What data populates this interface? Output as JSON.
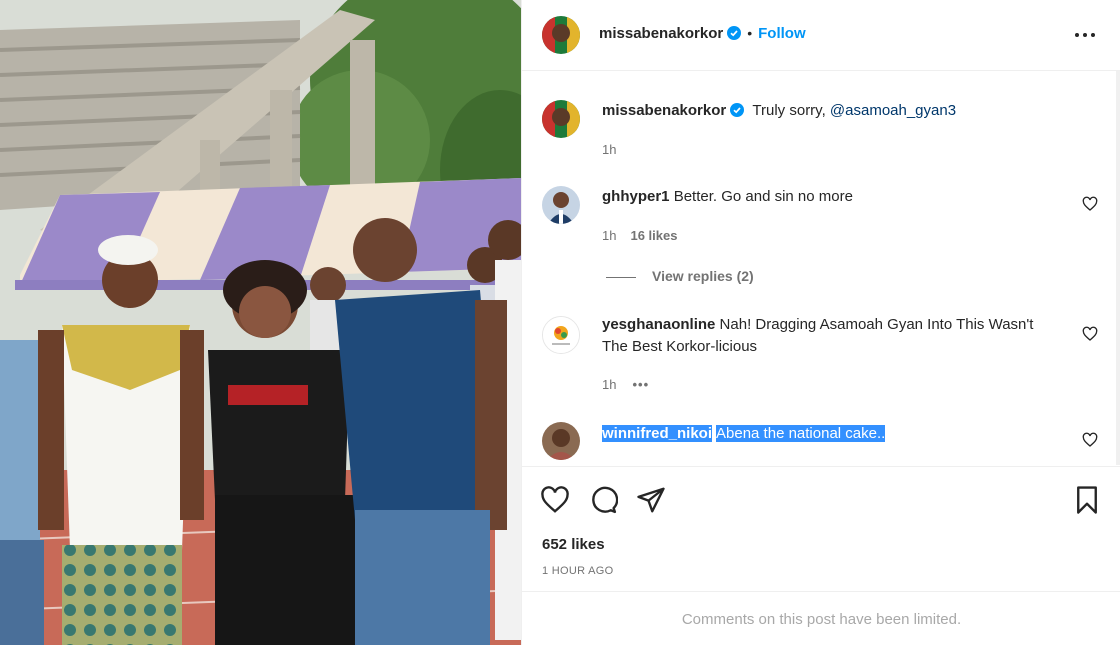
{
  "post": {
    "author": "missabenakorkor",
    "follow_label": "Follow",
    "separator": "•",
    "more_label": "•••"
  },
  "comments": [
    {
      "username": "missabenakorkor",
      "text_before": "Truly sorry, ",
      "mention": "@asamoah_gyan3",
      "time": "1h"
    },
    {
      "username": "ghhyper1",
      "text": "Better. Go and sin no more",
      "time": "1h",
      "likes": "16 likes",
      "view_replies": "View replies (2)"
    },
    {
      "username": "yesghanaonline",
      "text": "Nah! Dragging Asamoah Gyan Into This Wasn't The Best Korkor-licious",
      "time": "1h",
      "options": "•••"
    },
    {
      "username": "winnifred_nikoi",
      "text": "Abena the national cake.."
    }
  ],
  "footer": {
    "likes": "652 likes",
    "time_ago": "1 HOUR AGO",
    "comments_limited": "Comments on this post have been limited."
  },
  "icons": {
    "more": "more-icon",
    "like": "heart-icon",
    "comment": "comment-icon",
    "share": "share-icon",
    "save": "bookmark-icon",
    "verified": "verified-badge-icon"
  },
  "colors": {
    "accent": "#0095f6",
    "verified": "#0095f6",
    "selection": "#3390ff",
    "muted": "#737373"
  }
}
